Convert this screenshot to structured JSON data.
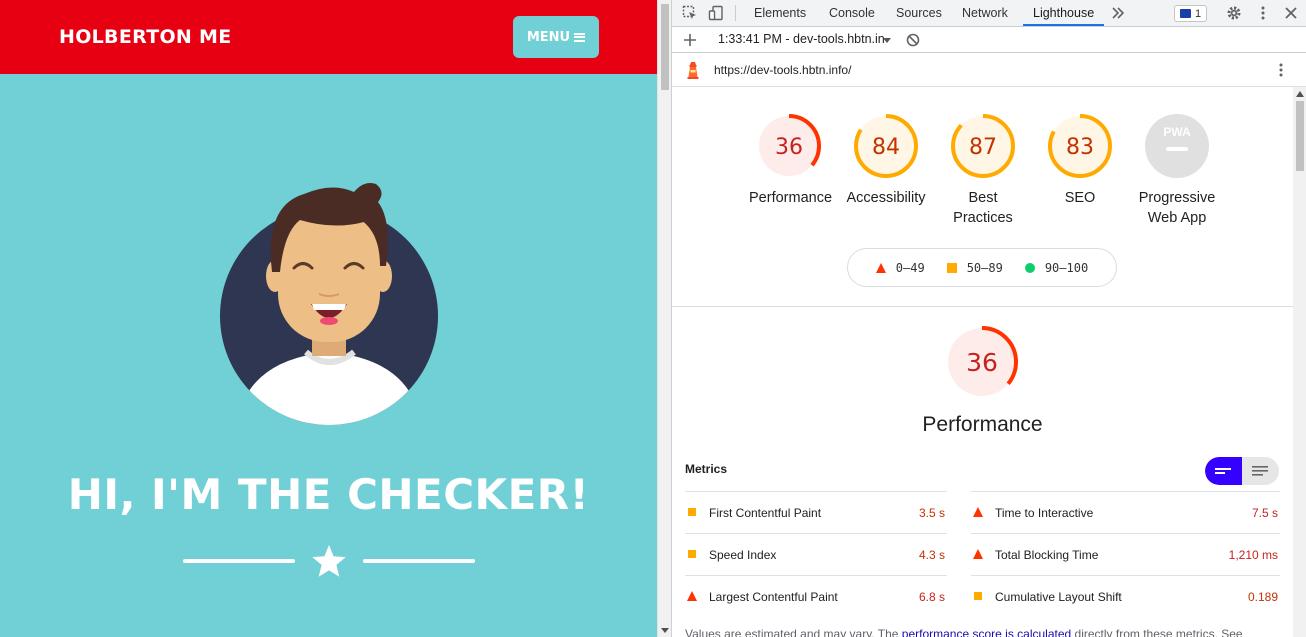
{
  "site": {
    "brand": "HOLBERTON ME",
    "menu_label": "MENU",
    "hero_title": "HI, I'M THE CHECKER!"
  },
  "devtools": {
    "tabs": [
      {
        "label": "Elements"
      },
      {
        "label": "Console"
      },
      {
        "label": "Sources"
      },
      {
        "label": "Network"
      },
      {
        "label": "Lighthouse"
      }
    ],
    "active_tab": "Lighthouse",
    "message_count": "1",
    "report_selector": "1:33:41 PM - dev-tools.hbtn.in",
    "url": "https://dev-tools.hbtn.info/",
    "categories": [
      {
        "label": "Performance",
        "score": "36",
        "score_value": 36
      },
      {
        "label": "Accessibility",
        "score": "84",
        "score_value": 84
      },
      {
        "label": "Best Practices",
        "score": "87",
        "score_value": 87
      },
      {
        "label": "SEO",
        "score": "83",
        "score_value": 83
      },
      {
        "label": "Progressive Web App",
        "score": "",
        "badge": "PWA"
      }
    ],
    "legend": [
      {
        "range": "0–49",
        "shape": "triangle",
        "color": "#ff3300"
      },
      {
        "range": "50–89",
        "shape": "square",
        "color": "#ffaa00"
      },
      {
        "range": "90–100",
        "shape": "circle",
        "color": "#0cce6b"
      }
    ],
    "performance": {
      "title": "Performance",
      "score": "36",
      "score_value": 36,
      "metrics_label": "Metrics",
      "metrics": [
        {
          "name": "First Contentful Paint",
          "value": "3.5 s",
          "rating": "average"
        },
        {
          "name": "Time to Interactive",
          "value": "7.5 s",
          "rating": "fail"
        },
        {
          "name": "Speed Index",
          "value": "4.3 s",
          "rating": "average"
        },
        {
          "name": "Total Blocking Time",
          "value": "1,210 ms",
          "rating": "fail"
        },
        {
          "name": "Largest Contentful Paint",
          "value": "6.8 s",
          "rating": "fail"
        },
        {
          "name": "Cumulative Layout Shift",
          "value": "0.189",
          "rating": "average"
        }
      ],
      "footnote_prefix": "Values are estimated and may vary. The ",
      "footnote_link": "performance score is calculated",
      "footnote_suffix": " directly from these metrics. See"
    },
    "colors": {
      "fail": "#ff3300",
      "fail_text": "#c7221f",
      "average": "#ffaa00",
      "average_text": "#c33300",
      "fail_bg": "#fdecea",
      "average_bg": "#fff6e5",
      "accent": "#1a73e8",
      "toggle": "#3400ff"
    }
  }
}
